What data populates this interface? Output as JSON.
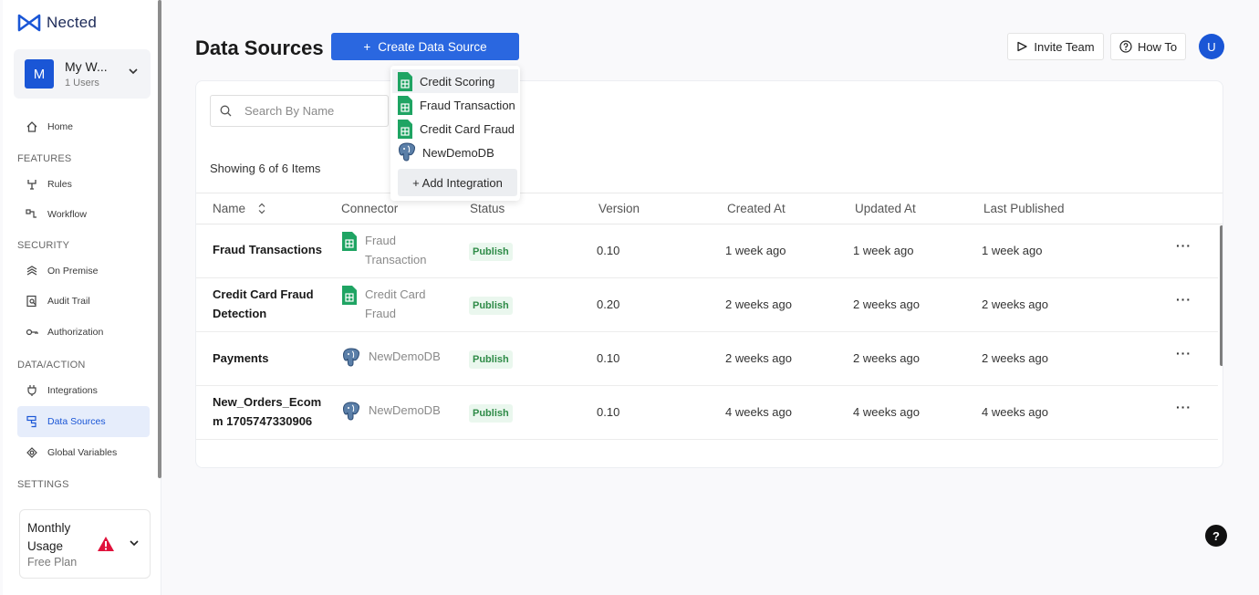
{
  "app": {
    "logo_text": "Nected"
  },
  "workspace": {
    "initial": "M",
    "name": "My W...",
    "users": "1 Users"
  },
  "nav": {
    "home": "Home",
    "features_title": "FEATURES",
    "rules": "Rules",
    "workflow": "Workflow",
    "security_title": "SECURITY",
    "on_premise": "On Premise",
    "audit_trail": "Audit Trail",
    "authorization": "Authorization",
    "data_action_title": "DATA/ACTION",
    "integrations": "Integrations",
    "data_sources": "Data Sources",
    "global_variables": "Global Variables",
    "settings_title": "SETTINGS"
  },
  "usage": {
    "title": "Monthly Usage",
    "plan": "Free Plan"
  },
  "header": {
    "title": "Data Sources",
    "create_button": "Create Data Source",
    "invite_button": "Invite Team",
    "howto_button": "How To",
    "user_initial": "U"
  },
  "search": {
    "placeholder": "Search By Name"
  },
  "summary": "Showing 6 of 6 Items",
  "table": {
    "columns": {
      "name": "Name",
      "connector": "Connector",
      "status": "Status",
      "version": "Version",
      "created": "Created At",
      "updated": "Updated At",
      "published": "Last Published"
    },
    "rows": [
      {
        "name": "Fraud Transactions",
        "connector": "Fraud Transaction",
        "connector_type": "sheets-icon",
        "status": "Publish",
        "version": "0.10",
        "created": "1 week ago",
        "updated": "1 week ago",
        "published": "1 week ago"
      },
      {
        "name": "Credit Card Fraud Detection",
        "connector": "Credit Card Fraud",
        "connector_type": "sheets-icon",
        "status": "Publish",
        "version": "0.20",
        "created": "2 weeks ago",
        "updated": "2 weeks ago",
        "published": "2 weeks ago"
      },
      {
        "name": "Payments",
        "connector": "NewDemoDB",
        "connector_type": "postgres-icon",
        "status": "Publish",
        "version": "0.10",
        "created": "2 weeks ago",
        "updated": "2 weeks ago",
        "published": "2 weeks ago"
      },
      {
        "name": "New_Orders_Ecom m 1705747330906",
        "connector": "NewDemoDB",
        "connector_type": "postgres-icon",
        "status": "Publish",
        "version": "0.10",
        "created": "4 weeks ago",
        "updated": "4 weeks ago",
        "published": "4 weeks ago"
      }
    ]
  },
  "dropdown": {
    "items": [
      {
        "label": "Credit Scoring",
        "icon": "sheets-icon"
      },
      {
        "label": "Fraud Transaction",
        "icon": "sheets-icon"
      },
      {
        "label": "Credit Card Fraud",
        "icon": "sheets-icon"
      },
      {
        "label": "NewDemoDB",
        "icon": "postgres-icon"
      }
    ],
    "add_label": "+ Add Integration"
  },
  "help_label": "?",
  "colors": {
    "primary": "#2a67e0",
    "publish_text": "#2e8b47",
    "publish_bg": "#eaf7ee",
    "sheets": "#1fa463",
    "warning": "#e0123c"
  }
}
